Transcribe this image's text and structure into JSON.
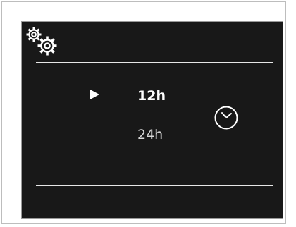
{
  "settings_icon": "gears-icon",
  "time_format": {
    "options": [
      "12h",
      "24h"
    ],
    "selected_index": 0
  },
  "clock_icon": "clock-icon",
  "colors": {
    "screen_background": "#181818",
    "foreground": "#ffffff"
  }
}
